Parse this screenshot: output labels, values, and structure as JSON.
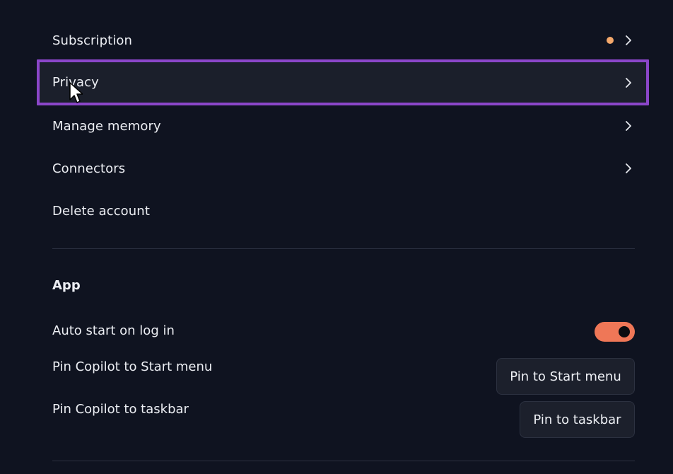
{
  "account": {
    "items": [
      {
        "label": "Subscription",
        "has_badge": true,
        "has_chevron": true
      },
      {
        "label": "Privacy",
        "has_badge": false,
        "has_chevron": true,
        "highlighted": true
      },
      {
        "label": "Manage memory",
        "has_badge": false,
        "has_chevron": true
      },
      {
        "label": "Connectors",
        "has_badge": false,
        "has_chevron": true
      },
      {
        "label": "Delete account",
        "has_badge": false,
        "has_chevron": false
      }
    ]
  },
  "app": {
    "title": "App",
    "auto_start": {
      "label": "Auto start on log in",
      "enabled": true
    },
    "pin_start": {
      "label": "Pin Copilot to Start menu",
      "button": "Pin to Start menu"
    },
    "pin_taskbar": {
      "label": "Pin Copilot to taskbar",
      "button": "Pin to taskbar"
    }
  },
  "colors": {
    "background": "#0f1320",
    "highlight_border": "#8b46c9",
    "badge": "#f4a86b",
    "toggle_on": "#ef7757"
  },
  "icons": {
    "chevron": "chevron-right-icon",
    "badge": "notification-dot-icon",
    "cursor": "mouse-pointer-icon"
  }
}
